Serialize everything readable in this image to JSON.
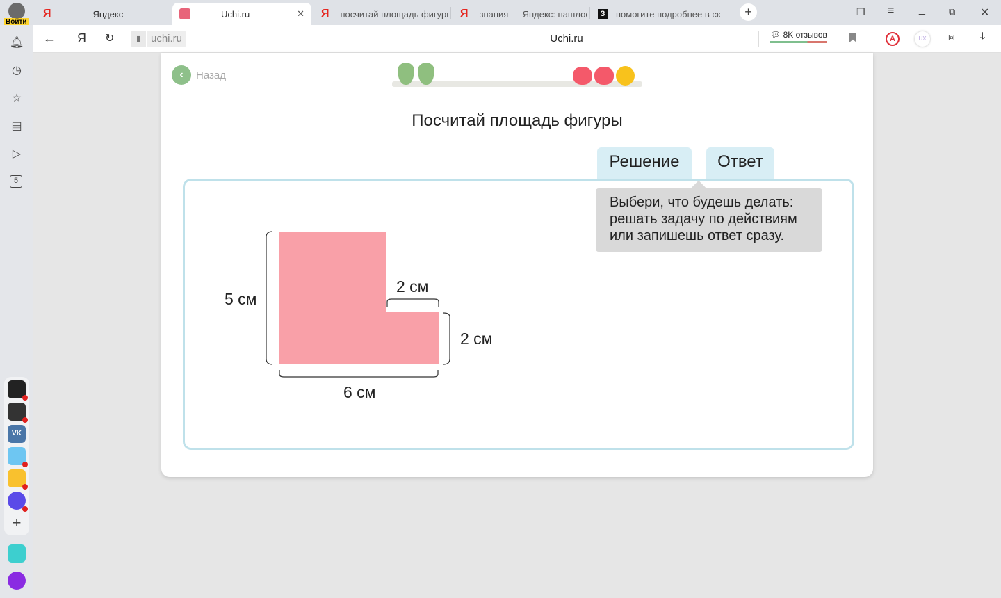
{
  "browser": {
    "login_label": "Войти",
    "tabs": [
      {
        "title": "Яндекс",
        "icon": "yandex-icon"
      },
      {
        "title": "Uchi.ru",
        "icon": "uchi-icon",
        "active": true
      },
      {
        "title": "посчитай площадь фигуры",
        "icon": "yandex-icon"
      },
      {
        "title": "знания — Яндекс: нашлос",
        "icon": "yandex-icon"
      },
      {
        "title": "помогите подробнее в ск",
        "icon": "znanija-icon"
      }
    ],
    "url": "uchi.ru",
    "page_title": "Uchi.ru",
    "reviews": "8K отзывов"
  },
  "page": {
    "back_label": "Назад",
    "title": "Посчитай площадь фигуры",
    "tab_solution": "Решение",
    "tab_answer": "Ответ",
    "hint": "Выбери, что будешь делать: решать задачу по действиям или запишешь ответ сразу.",
    "figure": {
      "color": "#f9a0a8",
      "label_height": "5 см",
      "label_width": "6 см",
      "label_step_width": "2 см",
      "label_step_height": "2 см"
    },
    "progress": {
      "pears": 2,
      "apples": 2,
      "oranges": 1
    }
  }
}
